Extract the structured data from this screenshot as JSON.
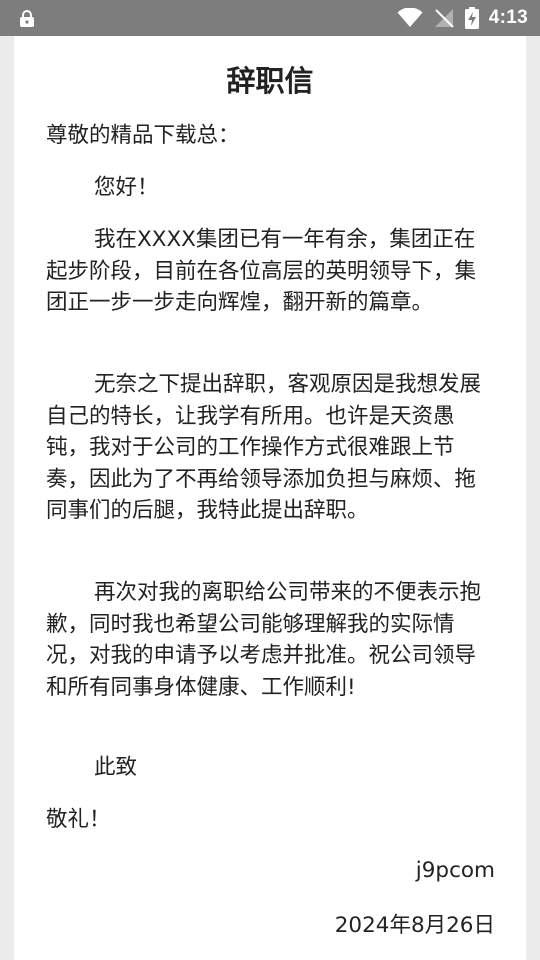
{
  "status_bar": {
    "time": "4:13",
    "icons": [
      "lock-icon",
      "wifi-icon",
      "signal-off-icon",
      "battery-charging-icon"
    ]
  },
  "letter": {
    "title": "辞职信",
    "salutation": "尊敬的精品下载总：",
    "greeting": "您好！",
    "paragraphs": [
      "我在XXXX集团已有一年有余，集团正在起步阶段，目前在各位高层的英明领导下，集团正一步一步走向辉煌，翻开新的篇章。",
      "无奈之下提出辞职，客观原因是我想发展自己的特长，让我学有所用。也许是天资愚钝，我对于公司的工作操作方式很难跟上节奏，因此为了不再给领导添加负担与麻烦、拖同事们的后腿，我特此提出辞职。",
      "再次对我的离职给公司带来的不便表示抱歉，同时我也希望公司能够理解我的实际情况，对我的申请予以考虑并批准。祝公司领导和所有同事身体健康、工作顺利!"
    ],
    "closing_1": "此致",
    "closing_2": "敬礼！",
    "signature": "j9pcom",
    "date": "2024年8月26日"
  }
}
